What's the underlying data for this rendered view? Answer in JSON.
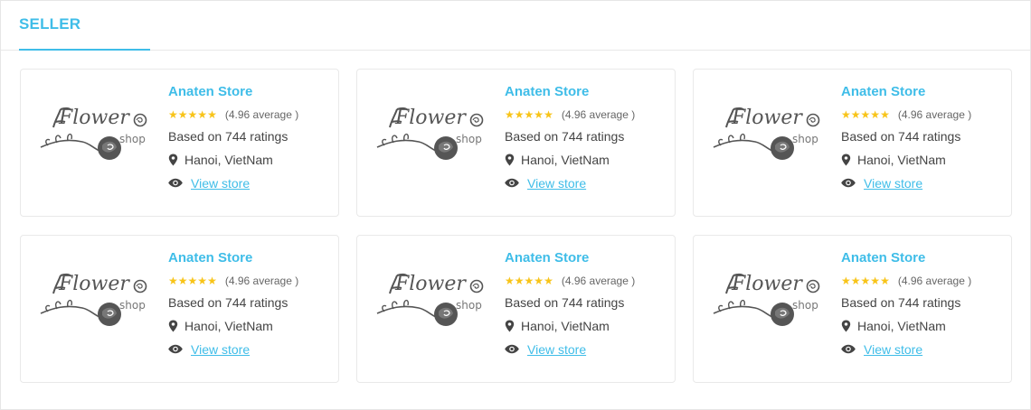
{
  "section": {
    "title": "SELLER"
  },
  "colors": {
    "accent": "#3fbde8",
    "star": "#f8c419",
    "text": "#444444"
  },
  "sellers": [
    {
      "logo_text": "Flower",
      "logo_sub": "shop",
      "name": "Anaten Store",
      "rating_stars": 5,
      "average_text": "(4.96 average )",
      "ratings_text": "Based on 744 ratings",
      "location": "Hanoi, VietNam",
      "link": "View store",
      "location_icon": "map-pin-icon",
      "view_icon": "eye-icon"
    },
    {
      "logo_text": "Flower",
      "logo_sub": "shop",
      "name": "Anaten Store",
      "rating_stars": 5,
      "average_text": "(4.96 average )",
      "ratings_text": "Based on 744 ratings",
      "location": "Hanoi, VietNam",
      "link": "View store",
      "location_icon": "map-pin-icon",
      "view_icon": "eye-icon"
    },
    {
      "logo_text": "Flower",
      "logo_sub": "shop",
      "name": "Anaten Store",
      "rating_stars": 5,
      "average_text": "(4.96 average )",
      "ratings_text": "Based on 744 ratings",
      "location": "Hanoi, VietNam",
      "link": "View store",
      "location_icon": "map-pin-icon",
      "view_icon": "eye-icon"
    },
    {
      "logo_text": "Flower",
      "logo_sub": "shop",
      "name": "Anaten Store",
      "rating_stars": 5,
      "average_text": "(4.96 average )",
      "ratings_text": "Based on 744 ratings",
      "location": "Hanoi, VietNam",
      "link": "View store",
      "location_icon": "map-pin-icon",
      "view_icon": "eye-icon"
    },
    {
      "logo_text": "Flower",
      "logo_sub": "shop",
      "name": "Anaten Store",
      "rating_stars": 5,
      "average_text": "(4.96 average )",
      "ratings_text": "Based on 744 ratings",
      "location": "Hanoi, VietNam",
      "link": "View store",
      "location_icon": "map-pin-icon",
      "view_icon": "eye-icon"
    },
    {
      "logo_text": "Flower",
      "logo_sub": "shop",
      "name": "Anaten Store",
      "rating_stars": 5,
      "average_text": "(4.96 average )",
      "ratings_text": "Based on 744 ratings",
      "location": "Hanoi, VietNam",
      "link": "View store",
      "location_icon": "map-pin-icon",
      "view_icon": "eye-icon"
    }
  ]
}
